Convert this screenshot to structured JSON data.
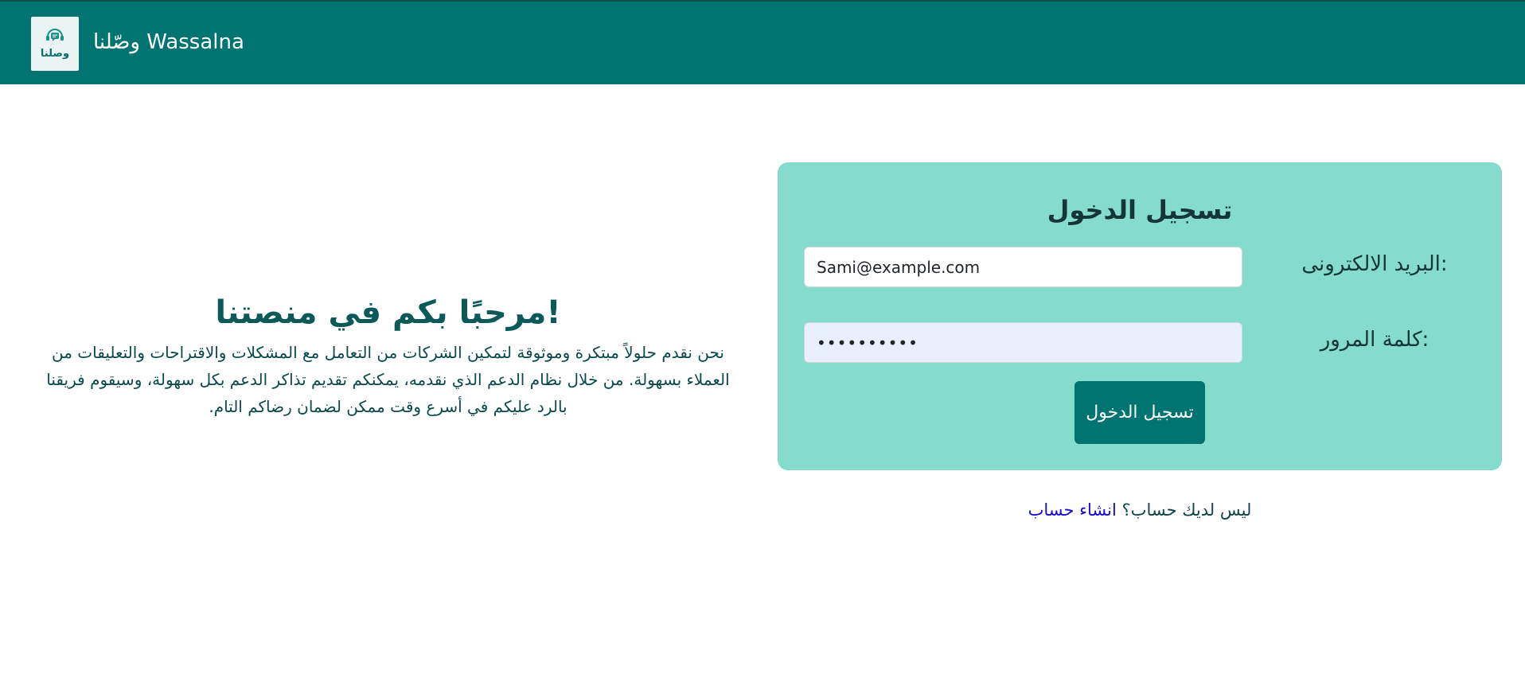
{
  "header": {
    "logo_text": "وصلنا",
    "brand": "وصّلنا Wassalna"
  },
  "welcome": {
    "title": "!مرحبًا بكم في منصتنا",
    "description": "نحن نقدم حلولاً مبتكرة وموثوقة لتمكين الشركات من التعامل مع المشكلات والاقتراحات والتعليقات من العملاء بسهولة. من خلال نظام الدعم الذي نقدمه، يمكنكم تقديم تذاكر الدعم بكل سهولة، وسيقوم فريقنا بالرد عليكم في أسرع وقت ممكن لضمان رضاكم التام."
  },
  "login": {
    "title": "تسجيل الدخول",
    "email_label": "البريد الالكترونى:",
    "email_value": "Sami@example.com",
    "password_label": "كلمة المرور:",
    "password_value": "••••••••••",
    "submit_label": "تسجيل الدخول"
  },
  "signup": {
    "prompt": "ليس لديك حساب؟",
    "link_label": "انشاء حساب"
  },
  "colors": {
    "navbar": "#007470",
    "card": "#85dccc",
    "button": "#007470",
    "link": "#1a0dcc"
  },
  "icons": {
    "logo": "chat-support-headset-icon"
  }
}
